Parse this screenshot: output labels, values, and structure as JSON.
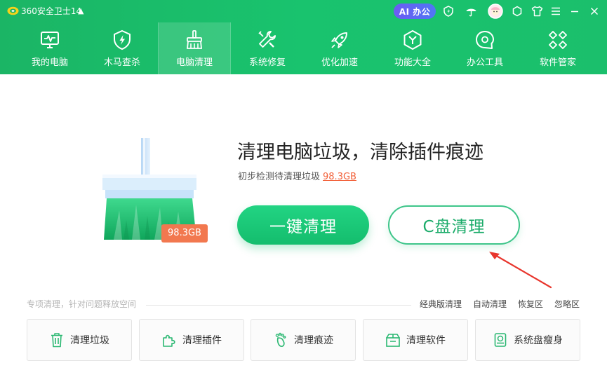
{
  "app": {
    "title": "360安全卫士14",
    "update_icon": "arrow-up-icon"
  },
  "titlebar": {
    "ai_label": "AI 办公"
  },
  "nav": {
    "items": [
      {
        "label": "我的电脑",
        "icon": "monitor-icon"
      },
      {
        "label": "木马查杀",
        "icon": "shield-bolt-icon"
      },
      {
        "label": "电脑清理",
        "icon": "broom-icon",
        "active": true
      },
      {
        "label": "系统修复",
        "icon": "wrench-icon"
      },
      {
        "label": "优化加速",
        "icon": "rocket-icon"
      },
      {
        "label": "功能大全",
        "icon": "hexagon-icon"
      },
      {
        "label": "办公工具",
        "icon": "chat-bubble-icon"
      },
      {
        "label": "软件管家",
        "icon": "apps-icon"
      }
    ]
  },
  "hero": {
    "headline": "清理电脑垃圾，清除插件痕迹",
    "sub_prefix": "初步检测待清理垃圾",
    "junk_size": "98.3GB",
    "badge": "98.3GB",
    "primary_button": "一键清理",
    "secondary_button": "C盘清理"
  },
  "tools": {
    "hint": "专项清理，针对问题释放空间",
    "links": [
      "经典版清理",
      "自动清理",
      "恢复区",
      "忽略区"
    ],
    "items": [
      {
        "label": "清理垃圾",
        "icon": "trash-icon"
      },
      {
        "label": "清理插件",
        "icon": "puzzle-icon"
      },
      {
        "label": "清理痕迹",
        "icon": "footprint-icon"
      },
      {
        "label": "清理软件",
        "icon": "software-box-icon"
      },
      {
        "label": "系统盘瘦身",
        "icon": "disk-icon"
      }
    ]
  },
  "colors": {
    "brand_green": "#19c36e",
    "accent_orange": "#f2613a",
    "ai_purple": "#6d5bf2"
  }
}
